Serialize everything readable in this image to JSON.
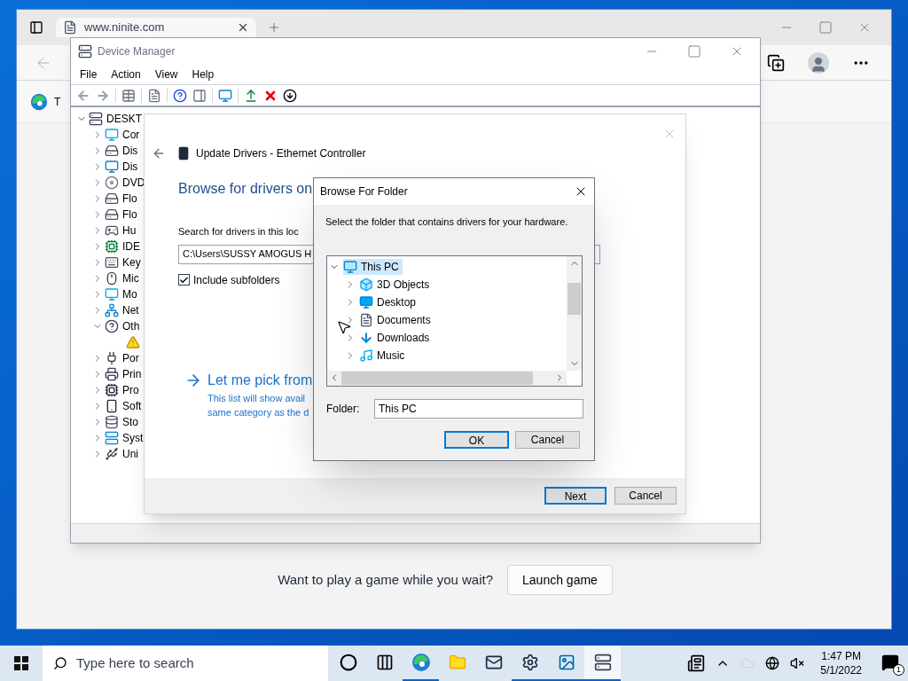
{
  "browser": {
    "tab": {
      "title": "www.ninite.com"
    },
    "bookmark_text": "T",
    "page": {
      "prompt": "Want to play a game while you wait?",
      "button": "Launch game"
    }
  },
  "device_manager": {
    "title": "Device Manager",
    "menu": [
      "File",
      "Action",
      "View",
      "Help"
    ],
    "tree": {
      "label": "DESKT",
      "expanded": true,
      "children": [
        {
          "label": "Cor",
          "expanded": false
        },
        {
          "label": "Dis",
          "expanded": false
        },
        {
          "label": "Dis",
          "expanded": false
        },
        {
          "label": "DVD",
          "expanded": false
        },
        {
          "label": "Flo",
          "expanded": false
        },
        {
          "label": "Flo",
          "expanded": false
        },
        {
          "label": "Hu",
          "expanded": false
        },
        {
          "label": "IDE",
          "expanded": false
        },
        {
          "label": "Key",
          "expanded": false
        },
        {
          "label": "Mic",
          "expanded": false
        },
        {
          "label": "Mo",
          "expanded": false
        },
        {
          "label": "Net",
          "expanded": false
        },
        {
          "label": "Oth",
          "expanded": true,
          "children": [
            {
              "warning": true
            }
          ]
        },
        {
          "label": "Por",
          "expanded": false
        },
        {
          "label": "Prin",
          "expanded": false
        },
        {
          "label": "Pro",
          "expanded": false
        },
        {
          "label": "Soft",
          "expanded": false
        },
        {
          "label": "Sto",
          "expanded": false
        },
        {
          "label": "Syst",
          "expanded": false
        },
        {
          "label": "Uni",
          "expanded": false
        }
      ]
    }
  },
  "update_drivers": {
    "title": "Update Drivers - Ethernet Controller",
    "heading": "Browse for drivers on",
    "search_label": "Search for drivers in this loc",
    "path_value": "C:\\Users\\SUSSY AMOGUS H",
    "include_subfolders": {
      "label": "Include subfolders",
      "checked": true
    },
    "pick_link": "Let me pick from",
    "pick_description": [
      "This list will show avail",
      "same category as the d"
    ],
    "buttons": [
      {
        "label": "Next",
        "default": true
      },
      {
        "label": "Cancel",
        "default": false
      }
    ]
  },
  "browse_folder": {
    "title": "Browse For Folder",
    "instruction": "Select the folder that contains drivers for your hardware.",
    "tree": {
      "label": "This PC",
      "expanded": true,
      "selected": true,
      "children": [
        {
          "label": "3D Objects",
          "expanded": false,
          "selected": false
        },
        {
          "label": "Desktop",
          "expanded": false,
          "selected": false
        },
        {
          "label": "Documents",
          "expanded": false,
          "selected": false
        },
        {
          "label": "Downloads",
          "expanded": false,
          "selected": false
        },
        {
          "label": "Music",
          "expanded": false,
          "selected": false
        }
      ]
    },
    "folder_field": {
      "label": "Folder:",
      "value": "This PC"
    },
    "buttons": [
      {
        "label": "OK",
        "default": true
      },
      {
        "label": "Cancel",
        "default": false
      }
    ]
  },
  "taskbar": {
    "search_placeholder": "Type here to search",
    "apps": [
      {
        "kind": "cortana",
        "running": false,
        "active": false
      },
      {
        "kind": "task-view",
        "running": false,
        "active": false
      },
      {
        "kind": "browser",
        "running": true,
        "active": false
      },
      {
        "kind": "folder",
        "running": false,
        "active": false
      },
      {
        "kind": "mail",
        "running": false,
        "active": false
      },
      {
        "kind": "settings",
        "running": true,
        "active": false
      },
      {
        "kind": "image",
        "running": true,
        "active": false
      },
      {
        "kind": "device",
        "running": true,
        "active": true
      }
    ],
    "clock": {
      "time": "1:47 PM",
      "date": "5/1/2022"
    },
    "notification_count": "1"
  }
}
